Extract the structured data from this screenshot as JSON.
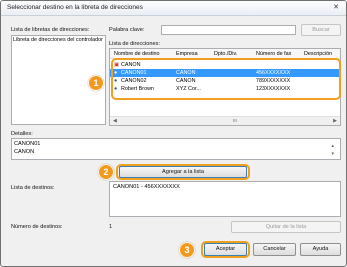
{
  "window": {
    "title": "Seleccionar destino en la libreta de direcciones",
    "close_glyph": "✕"
  },
  "address_books": {
    "label": "Lista de libretas de direcciones:",
    "items": [
      "Libreta de direcciones del controlador"
    ]
  },
  "keyword": {
    "label": "Palabra clave:",
    "value": "",
    "search_label": "Buscar"
  },
  "destinations": {
    "label": "Lista de direcciones:",
    "columns": [
      "Nombre de destino",
      "Empresa",
      "Dpto./Div.",
      "Número de fax",
      "Descripción"
    ],
    "rows": [
      {
        "name": "CANON",
        "company": "",
        "dept": "",
        "fax": "",
        "icon": "group-icon"
      },
      {
        "name": "CANON01",
        "company": "CANON",
        "dept": "",
        "fax": "456XXXXXXX",
        "icon": "person-icon"
      },
      {
        "name": "CANON02",
        "company": "CANON",
        "dept": "",
        "fax": "789XXXXXXX",
        "icon": "person-icon"
      },
      {
        "name": "Robert Brown",
        "company": "XYZ Cor...",
        "dept": "",
        "fax": "123XXXXXXX",
        "icon": "person-icon"
      }
    ],
    "scroll_marker": "III"
  },
  "details": {
    "label": "Detalles:",
    "lines": [
      "CANON01",
      "CANON"
    ]
  },
  "add_button": "Agregar a la lista",
  "dest_list": {
    "label": "Lista de destinos:",
    "items": [
      "CANON01 - 456XXXXXXX"
    ]
  },
  "count": {
    "label": "Número de destinos:",
    "value": "1"
  },
  "remove_button": "Quitar de la lista",
  "footer": {
    "accept": "Aceptar",
    "cancel": "Cancelar",
    "help": "Ayuda"
  },
  "callouts": [
    "1",
    "2",
    "3"
  ],
  "colors": {
    "accent": "#f29a1d",
    "selection": "#3399ff"
  }
}
